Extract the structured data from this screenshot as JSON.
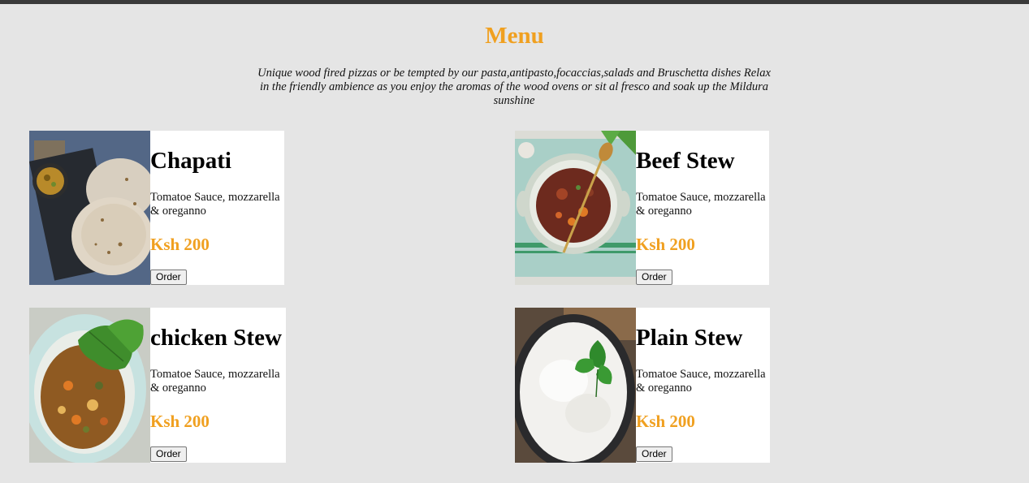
{
  "header": {
    "title": "Menu",
    "intro": "Unique wood fired pizzas or be tempted by our pasta,antipasto,focaccias,salads and Bruschetta dishes Relax in the friendly ambience as you enjoy the aromas of the wood ovens or sit al fresco and soak up the Mildura sunshine"
  },
  "items": [
    {
      "name": "Chapati",
      "description": "Tomatoe Sauce, mozzarella & oreganno",
      "price": "Ksh 200",
      "order_label": "Order",
      "image": "chapati-photo"
    },
    {
      "name": "Beef Stew",
      "description": "Tomatoe Sauce, mozzarella & oreganno",
      "price": "Ksh 200",
      "order_label": "Order",
      "image": "beef-stew-photo"
    },
    {
      "name": "chicken Stew",
      "description": "Tomatoe Sauce, mozzarella & oreganno",
      "price": "Ksh 200",
      "order_label": "Order",
      "image": "chicken-stew-photo"
    },
    {
      "name": "Plain Stew",
      "description": "Tomatoe Sauce, mozzarella & oreganno",
      "price": "Ksh 200",
      "order_label": "Order",
      "image": "rice-photo"
    }
  ],
  "colors": {
    "accent": "#f0a020",
    "background": "#e5e5e5",
    "card": "#ffffff"
  }
}
